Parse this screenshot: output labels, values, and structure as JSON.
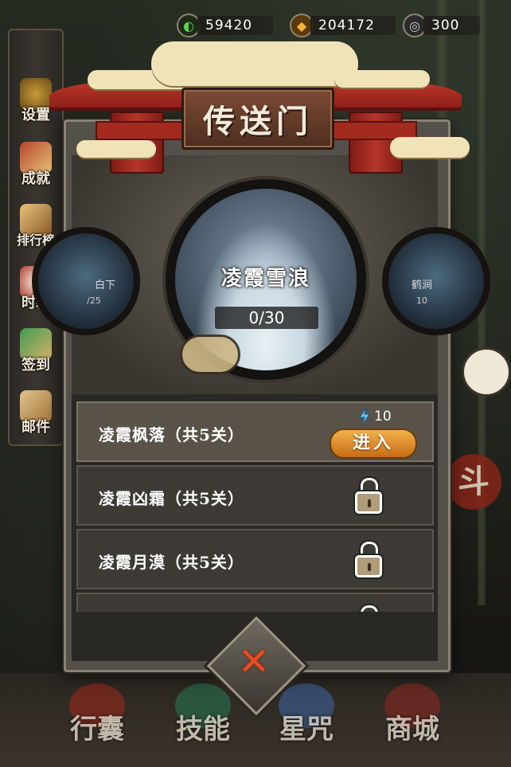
{
  "resources": [
    {
      "icon": "jade-icon",
      "value": "59420",
      "color": "#4fae3a"
    },
    {
      "icon": "coin-icon",
      "value": "204172",
      "color": "#e8a020"
    },
    {
      "icon": "swirl-icon",
      "value": "300",
      "color": "#9aa0a6"
    }
  ],
  "left_menu": [
    {
      "label": "设置",
      "icon": "gear-icon"
    },
    {
      "label": "成就",
      "icon": "scroll-icon"
    },
    {
      "label": "排行榜",
      "icon": "rank-scroll-icon"
    },
    {
      "label": "时装",
      "icon": "fox-mask-icon"
    },
    {
      "label": "签到",
      "icon": "checkin-icon"
    },
    {
      "label": "邮件",
      "icon": "mail-icon"
    }
  ],
  "bottom_menu": [
    {
      "label": "行囊",
      "icon": "bag-icon"
    },
    {
      "label": "技能",
      "icon": "skill-icon"
    },
    {
      "label": "星咒",
      "icon": "star-spell-icon"
    },
    {
      "label": "商城",
      "icon": "shop-icon"
    }
  ],
  "side_badge": "斗",
  "modal": {
    "title": "传送门",
    "current_stage": {
      "name": "凌霞雪浪",
      "progress": "0/30"
    },
    "prev_stage": {
      "name": "白下",
      "progress": "/25"
    },
    "next_stage": {
      "name": "鹤涧",
      "progress": "10"
    },
    "levels": [
      {
        "name": "凌霞枫落（共5关）",
        "state": "unlocked",
        "cost": "10",
        "button": "进入"
      },
      {
        "name": "凌霞凶霜（共5关）",
        "state": "locked"
      },
      {
        "name": "凌霞月漠（共5关）",
        "state": "locked"
      },
      {
        "name": "",
        "state": "locked"
      }
    ]
  }
}
